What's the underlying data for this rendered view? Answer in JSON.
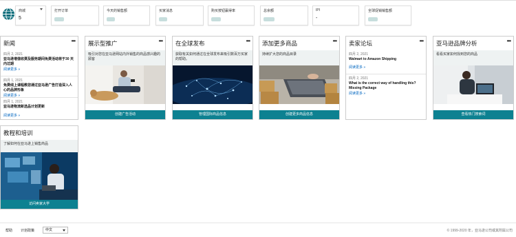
{
  "metrics": [
    {
      "label": "商城",
      "value": "5",
      "has_caret": true
    },
    {
      "label": "打开订单",
      "value": ""
    },
    {
      "label": "今天的销售额",
      "value": ""
    },
    {
      "label": "买家消息",
      "value": ""
    },
    {
      "label": "购买按钮赢得率",
      "value": ""
    },
    {
      "label": "总余额",
      "value": ""
    },
    {
      "label": "IPI",
      "value": "-"
    },
    {
      "label": "全球促销销售额",
      "value": ""
    }
  ],
  "cards": {
    "news": {
      "title": "新闻",
      "entries": [
        {
          "date": "四月 2, 2021",
          "headline": "亚马逊增值收费及服务期间免费活动将于30 天内过期",
          "link": "阅读更多 »"
        },
        {
          "date": "四月 1, 2021",
          "headline": "免费线上课程教您通过亚马逊广告打造深入人心的品牌形象",
          "link": "阅读更多 »"
        },
        {
          "date": "四月 1, 2021",
          "headline": "亚马逊物流新选品计划更新",
          "link": "阅读更多 »"
        }
      ]
    },
    "sponsored": {
      "title": "展示型推广",
      "description": "吸引对您在亚马逊网站内外销售的商品感兴趣的顾客",
      "cta": "创建广告活动"
    },
    "global": {
      "title": "在全球发布",
      "description": "获取有关如何通过在全球发布来吸引数百万买家的帮助。",
      "cta": "管理国际商品信息"
    },
    "add_products": {
      "title": "添加更多商品",
      "description": "持续扩大您的商品目录",
      "cta": "创建更多商品信息"
    },
    "forums": {
      "title": "卖家论坛",
      "entries": [
        {
          "date": "四月 2, 2021",
          "headline": "Walmart to Amazon Shipping",
          "link": "阅读更多 »"
        },
        {
          "date": "四月 2, 2021",
          "headline": "What is the correct way of handling this? Missing Package",
          "link": "阅读更多 »"
        }
      ]
    },
    "brand_analytics": {
      "title": "亚马逊品牌分析",
      "description": "看看买家如何找到您的商品",
      "cta": "查看热门搜索词"
    },
    "training": {
      "title": "教程和培训",
      "description": "了解如何在亚马逊上销售商品",
      "cta": "访问卖家大学"
    }
  },
  "more_glyph": "•••",
  "footer": {
    "help": "帮助",
    "policies": "计划政策",
    "language": "中文",
    "copyright": "© 1999-2020 年，亚马逊公司或其附属公司"
  },
  "colors": {
    "accent": "#0d8191",
    "link": "#0066c0",
    "band": "#eef2f2"
  }
}
